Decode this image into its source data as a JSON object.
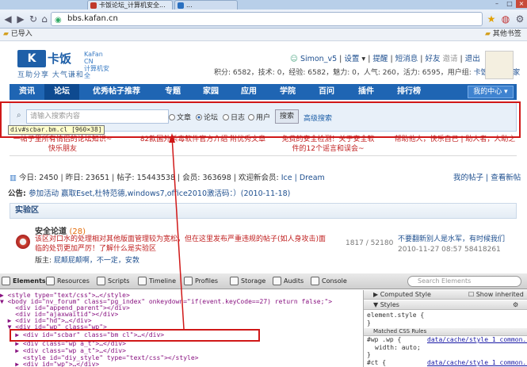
{
  "browser": {
    "tabs": [
      {
        "title": "卡饭论坛_计算机安全..."
      },
      {
        "title": "..."
      },
      {
        "title": ""
      }
    ],
    "url": "bbs.kafan.cn",
    "bookmark_folder": "已导入",
    "bookmark_other": "其他书签"
  },
  "site": {
    "logo_cn": "卡饭",
    "logo_en_1": "KaFan CN",
    "logo_en_2": "计算机安全",
    "slogan": "互助分享    大气谦和",
    "user": {
      "name": "Simon_v5",
      "links": [
        "设置",
        "提醒",
        "短消息",
        "好友",
        "邀请",
        "退出"
      ],
      "stats": "积分: 6582，技术: 0，经验: 6582，魅力: 0，人气: 260，活力: 6595，用户组: ",
      "group": "卡饭_职业作家"
    },
    "nav": [
      "资讯",
      "论坛",
      "优秀帖子推荐",
      "专题",
      "家园",
      "应用",
      "学院",
      "百问",
      "插件",
      "排行榜"
    ],
    "my_center": "我的中心"
  },
  "search": {
    "placeholder": "请输入搜索内容",
    "options": [
      "文章",
      "论坛",
      "日志",
      "用户"
    ],
    "selected": "论坛",
    "button": "搜索",
    "advanced": "高级搜索",
    "tooltip": "div#scbar.bm.cl [960×38]"
  },
  "ads": [
    "一帖子里所有情侣的论坛知识~快乐朋友",
    "82款国外杀毒软件官方介绍 附优秀文章",
    "免费的安全检测！关于安全软件的12个谣言和误会~",
    "帮助他人，快乐自己 | 助人者，人助之"
  ],
  "forum_stats": {
    "today_label": "今日: ",
    "today": "2450",
    "yesterday_label": "昨日: ",
    "yesterday": "23651",
    "threads_label": "帖子: ",
    "threads": "15443538",
    "members_label": "会员: ",
    "members": "363698",
    "welcome": "欢迎新会员: ",
    "newest": "Ice | Dream",
    "my_threads": "我的帖子",
    "view_new": "查看新帖"
  },
  "announcement": {
    "label": "公告: ",
    "text": "参加活动 赢取Eset,杜特范德,windows7,office2010激活码：）(2010-11-18)"
  },
  "section": {
    "title": "实验区",
    "forum_name": "安全论道",
    "forum_count": "(28)",
    "description": "该区对口水的处理相对其他版面管理较为宽松，但在这里发布严重违规的帖子(如人身攻击)面临的处罚更加严厉！了解什么是实验区",
    "moderators_label": "版主: ",
    "moderators": "屁颠屁颠啊，不一定，安敦",
    "counts": "1817 / 52180",
    "last_post_title": "不要翻新别人是水军，有时候我们",
    "last_post_date": "2010-11-27 08:57 58418261"
  },
  "devtools": {
    "tabs": [
      "Elements",
      "Resources",
      "Scripts",
      "Timeline",
      "Profiles",
      "Storage",
      "Audits",
      "Console"
    ],
    "search_placeholder": "Search Elements",
    "dom_lines": [
      "▶ <style type=\"text/css\">…</style>",
      "▼ <body id=\"nv_forum\" class=\"pg_index\" onkeydown=\"if(event.keyCode==27) return false;\">",
      "    <div id=\"append_parent\"></div>",
      "    <div id=\"ajaxwaitid\"></div>",
      "  ▶ <div id=\"hd\">…</div>",
      "  ▼ <div id=\"wp\" class=\"wp\">",
      "    ▶ <div id=\"scbar\" class=\"bm cl\">…</div>",
      "    ▶ <div class=\"wp a_t\">…</div>",
      "    ▶ <div class=\"wp a_t\">…</div>",
      "      <style id=\"diy_style\" type=\"text/css\"></style>",
      "    ▶ <div id=\"wp\">…</div>"
    ],
    "styles": {
      "computed": "Computed Style",
      "show_inherited": "Show inherited",
      "styles_header": "Styles",
      "element_style": "element.style {",
      "close": "}",
      "matched": "Matched CSS Rules",
      "rule1_selector": "#wp .wp {",
      "rule1_link": "data/cache/style_1_common...",
      "rule1_prop": "width: auto;",
      "rule2_selector": "#ct {",
      "rule2_link": "data/cache/style_1_common..."
    }
  }
}
